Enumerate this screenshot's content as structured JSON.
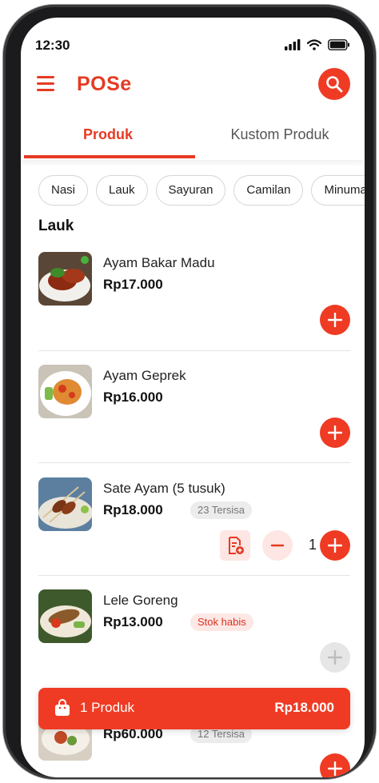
{
  "status_bar": {
    "time": "12:30"
  },
  "app": {
    "name": "POSe"
  },
  "tabs": [
    {
      "label": "Produk",
      "active": true
    },
    {
      "label": "Kustom Produk",
      "active": false
    }
  ],
  "categories": [
    "Nasi",
    "Lauk",
    "Sayuran",
    "Camilan",
    "Minuman"
  ],
  "section": {
    "title": "Lauk"
  },
  "products": [
    {
      "name": "Ayam Bakar Madu",
      "price": "Rp17.000",
      "stock_label": "",
      "available": true
    },
    {
      "name": "Ayam Geprek",
      "price": "Rp16.000",
      "stock_label": "",
      "available": true
    },
    {
      "name": "Sate Ayam (5 tusuk)",
      "price": "Rp18.000",
      "stock_label": "23 Tersisa",
      "available": true,
      "quantity": "1"
    },
    {
      "name": "Lele Goreng",
      "price": "Rp13.000",
      "stock_label": "Stok habis",
      "available": false
    },
    {
      "name": "",
      "price": "Rp60.000",
      "stock_label": "12 Tersisa",
      "available": true
    }
  ],
  "cart": {
    "count_label": "1 Produk",
    "total": "Rp18.000"
  },
  "colors": {
    "primary": "#ef3b24",
    "primary_light": "#fde6e3",
    "text": "#222222",
    "muted": "#777777"
  }
}
